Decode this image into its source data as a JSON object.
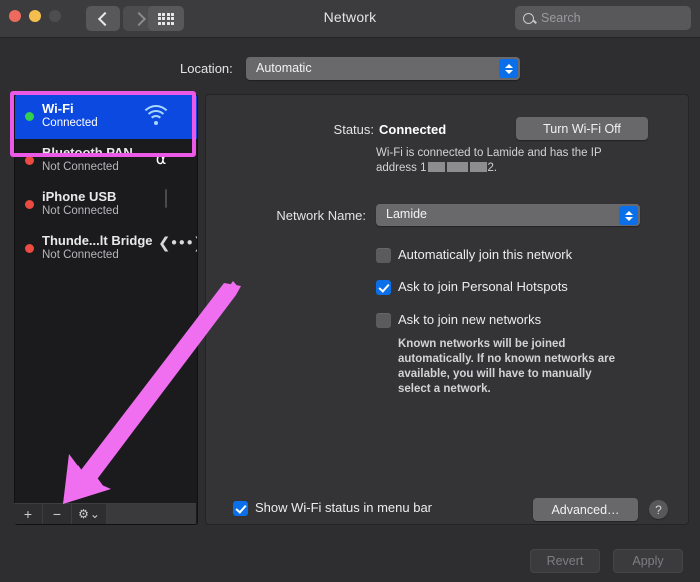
{
  "window": {
    "title": "Network",
    "traffic_lights": [
      "close",
      "minimize",
      "zoom"
    ]
  },
  "toolbar": {
    "back_label": "Back",
    "forward_label": "Forward",
    "show_all_label": "Show All",
    "search_placeholder": "Search"
  },
  "location": {
    "label": "Location:",
    "value": "Automatic"
  },
  "sidebar": {
    "services": [
      {
        "name": "Wi-Fi",
        "status": "Connected",
        "dot": "green",
        "icon": "wifi-icon",
        "selected": true
      },
      {
        "name": "Bluetooth PAN",
        "status": "Not Connected",
        "dot": "red",
        "icon": "bluetooth-icon",
        "selected": false
      },
      {
        "name": "iPhone USB",
        "status": "Not Connected",
        "dot": "red",
        "icon": "iphone-icon",
        "selected": false
      },
      {
        "name": "Thunde...lt Bridge",
        "status": "Not Connected",
        "dot": "red",
        "icon": "thunderbolt-bridge-icon",
        "selected": false
      }
    ],
    "add_label": "+",
    "remove_label": "−",
    "action_label": "⚙"
  },
  "main": {
    "status_label": "Status:",
    "status_value": "Connected",
    "turn_off_button": "Turn Wi-Fi Off",
    "status_desc_pre": "Wi-Fi is connected to Lamide and has the IP",
    "status_desc_line2_pre": "address 1",
    "status_desc_line2_post": "2.",
    "network_name_label": "Network Name:",
    "network_name_value": "Lamide",
    "checkboxes": [
      {
        "label": "Automatically join this network",
        "checked": false
      },
      {
        "label": "Ask to join Personal Hotspots",
        "checked": true
      },
      {
        "label": "Ask to join new networks",
        "checked": false
      }
    ],
    "help_text": "Known networks will be joined automatically. If no known networks are available, you will have to manually select a network.",
    "show_status_label": "Show Wi-Fi status in menu bar",
    "show_status_checked": true,
    "advanced_button": "Advanced…",
    "help_button": "?"
  },
  "footer": {
    "revert_button": "Revert",
    "apply_button": "Apply"
  },
  "annotation": {
    "highlight_color": "#eb59e6",
    "arrow_color": "#f06ef0",
    "arrow_target": "remove-service-button"
  }
}
